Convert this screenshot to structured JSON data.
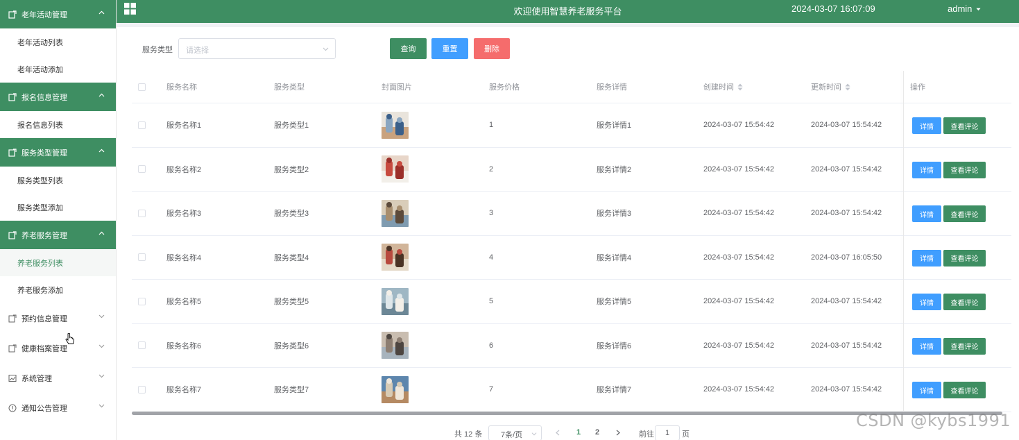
{
  "sidebar": {
    "groups": [
      {
        "label": "老年活动管理",
        "items": [
          "老年活动列表",
          "老年活动添加"
        ]
      },
      {
        "label": "报名信息管理",
        "items": [
          "报名信息列表"
        ]
      },
      {
        "label": "服务类型管理",
        "items": [
          "服务类型列表",
          "服务类型添加"
        ]
      },
      {
        "label": "养老服务管理",
        "items": [
          "养老服务列表",
          "养老服务添加"
        ]
      }
    ],
    "closed_groups": [
      "预约信息管理",
      "健康档案管理",
      "系统管理",
      "通知公告管理"
    ]
  },
  "header": {
    "title": "欢迎使用智慧养老服务平台",
    "datetime": "2024-03-07 16:07:09",
    "user": "admin"
  },
  "toolbar": {
    "filter_label": "服务类型",
    "select_placeholder": "请选择",
    "query_label": "查询",
    "reset_label": "重置",
    "delete_label": "删除"
  },
  "table": {
    "columns": [
      "服务名称",
      "服务类型",
      "封面图片",
      "服务价格",
      "服务详情",
      "创建时间",
      "更新时间",
      "操作"
    ],
    "detail_label": "详情",
    "comment_label": "查看评论",
    "rows": [
      {
        "name": "服务名称1",
        "type": "服务类型1",
        "price": "1",
        "detail": "服务详情1",
        "created": "2024-03-07 15:54:42",
        "updated": "2024-03-07 15:54:42"
      },
      {
        "name": "服务名称2",
        "type": "服务类型2",
        "price": "2",
        "detail": "服务详情2",
        "created": "2024-03-07 15:54:42",
        "updated": "2024-03-07 15:54:42"
      },
      {
        "name": "服务名称3",
        "type": "服务类型3",
        "price": "3",
        "detail": "服务详情3",
        "created": "2024-03-07 15:54:42",
        "updated": "2024-03-07 15:54:42"
      },
      {
        "name": "服务名称4",
        "type": "服务类型4",
        "price": "4",
        "detail": "服务详情4",
        "created": "2024-03-07 15:54:42",
        "updated": "2024-03-07 16:05:50"
      },
      {
        "name": "服务名称5",
        "type": "服务类型5",
        "price": "5",
        "detail": "服务详情5",
        "created": "2024-03-07 15:54:42",
        "updated": "2024-03-07 15:54:42"
      },
      {
        "name": "服务名称6",
        "type": "服务类型6",
        "price": "6",
        "detail": "服务详情6",
        "created": "2024-03-07 15:54:42",
        "updated": "2024-03-07 15:54:42"
      },
      {
        "name": "服务名称7",
        "type": "服务类型7",
        "price": "7",
        "detail": "服务详情7",
        "created": "2024-03-07 15:54:42",
        "updated": "2024-03-07 15:54:42"
      }
    ]
  },
  "pagination": {
    "total": "共 12 条",
    "page_size": "7条/页",
    "pages": [
      "1",
      "2"
    ],
    "goto_label": "前往",
    "goto_value": "1",
    "page_unit": "页"
  },
  "watermark": "CSDN @kybs1991",
  "colors": {
    "primary": "#3e8e62",
    "blue": "#409eff",
    "red": "#f56c6c"
  }
}
